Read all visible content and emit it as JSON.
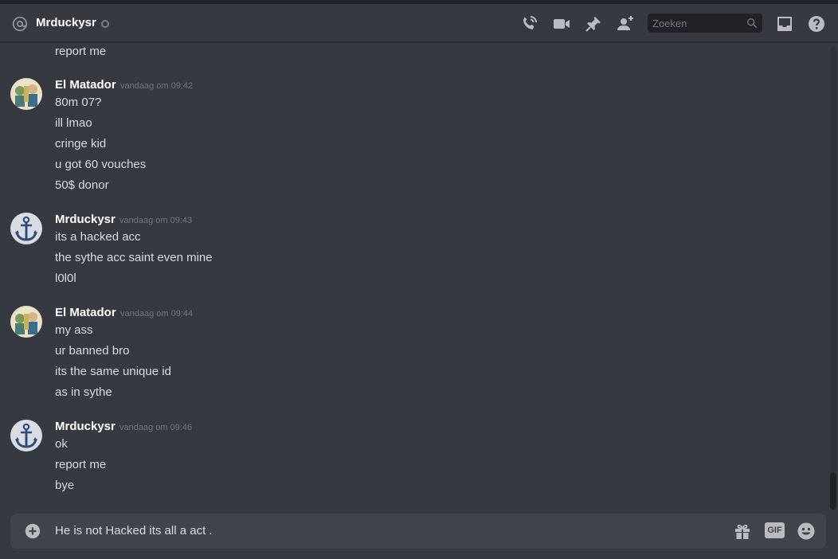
{
  "header": {
    "title": "Mrduckysr",
    "search_placeholder": "Zoeken",
    "icons": [
      "at-icon",
      "status-offline-icon",
      "call-icon",
      "video-icon",
      "pin-icon",
      "add-friend-icon",
      "search-icon",
      "inbox-icon",
      "help-icon"
    ]
  },
  "messages": {
    "orphan_line": "report me",
    "groups": [
      {
        "author": "El Matador",
        "timestamp": "vandaag om 09:42",
        "lines": [
          "80m 07?",
          "ill lmao",
          "cringe kid",
          "u got 60 vouches",
          "50$ donor"
        ]
      },
      {
        "author": "Mrduckysr",
        "timestamp": "vandaag om 09:43",
        "lines": [
          "its a hacked acc",
          "the sythe acc saint even mine",
          "l0l0l"
        ]
      },
      {
        "author": "El Matador",
        "timestamp": "vandaag om 09:44",
        "lines": [
          "my ass",
          "ur banned bro",
          "its the same unique id",
          "as in sythe"
        ]
      },
      {
        "author": "Mrduckysr",
        "timestamp": "vandaag om 09:46",
        "lines": [
          "ok",
          "report me",
          "bye"
        ]
      }
    ]
  },
  "composer": {
    "value": "He is not Hacked its all a act .",
    "gif_label": "GIF",
    "icons": [
      "plus-circle-icon",
      "gift-icon",
      "gif-icon",
      "emoji-icon"
    ]
  },
  "colors": {
    "background": "#36393f",
    "header_text": "#ffffff",
    "message_text": "#dcddde",
    "timestamp": "#72767d",
    "input_bg": "#40444b",
    "search_bg": "#202225"
  }
}
